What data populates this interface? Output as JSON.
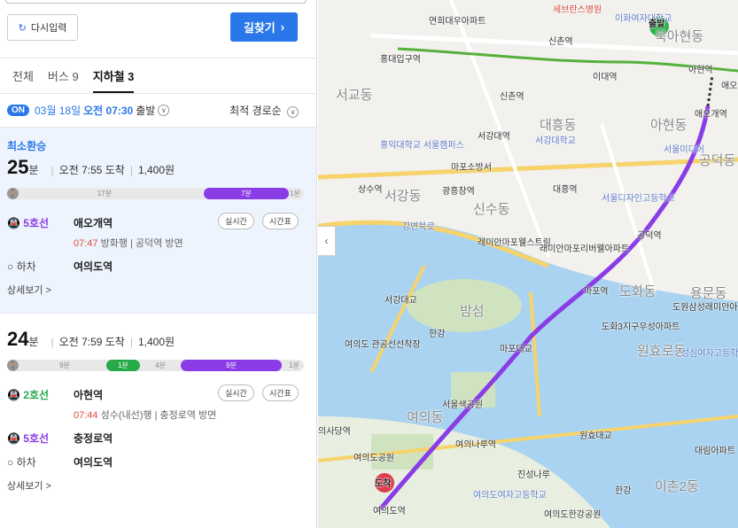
{
  "toolbar": {
    "reset_label": "다시입력",
    "find_label": "길찾기",
    "find_arrow": "›"
  },
  "tabs": [
    {
      "label": "전체"
    },
    {
      "label": "버스 9"
    },
    {
      "label": "지하철 3"
    }
  ],
  "filter": {
    "on": "ON",
    "date": "03월 18일",
    "time": "오전 07:30",
    "depart": "출발",
    "sort": "최적 경로순"
  },
  "routes": [
    {
      "badge": "최소환승",
      "minutes": "25",
      "unit": "분",
      "arrive": "오전 7:55 도착",
      "fare": "1,400원",
      "bar": {
        "walk1": "17분",
        "ride": "7분",
        "walk2": "1분"
      },
      "steps": [
        {
          "line": "5호선",
          "station": "애오개역",
          "time": "07:47",
          "dir": "방화행 | 공덕역 방면",
          "pill1": "실시간",
          "pill2": "시간표"
        },
        {
          "line": "하차",
          "station": "여의도역"
        }
      ],
      "detail": "상세보기 >"
    },
    {
      "minutes": "24",
      "unit": "분",
      "arrive": "오전 7:59 도착",
      "fare": "1,400원",
      "bar": {
        "walk1": "9분",
        "ride1": "1분",
        "walk2": "4분",
        "ride2": "9분",
        "walk3": "1분"
      },
      "steps": [
        {
          "line": "2호선",
          "station": "아현역",
          "time": "07:44",
          "dir": "성수(내선)행 | 충정로역 방면",
          "pill1": "실시간",
          "pill2": "시간표"
        },
        {
          "line": "5호선",
          "station": "충정로역"
        },
        {
          "line": "하차",
          "station": "여의도역"
        }
      ],
      "detail": "상세보기 >"
    }
  ],
  "map": {
    "labels": [
      "세브란스병원",
      "연희대우아파트",
      "이화여자대학교",
      "출발",
      "북아현동",
      "홍대입구역",
      "신촌역",
      "이대역",
      "아현역",
      "애오",
      "서교동",
      "신촌역",
      "서강대역",
      "대흥동",
      "서강대학교",
      "아현동",
      "애오개역",
      "서울미디어",
      "공덕동",
      "홍익대학교 서울캠퍼스",
      "마포소방서",
      "상수역",
      "서강동",
      "광흥창역",
      "신수동",
      "대흥역",
      "서울디자인고등학교",
      "공덕역",
      "강변북로",
      "레미안마포웰스트림",
      "래미안마포리버웰아파트",
      "마포역",
      "도화동",
      "용문동",
      "도원삼성래미안아파트",
      "서강대교",
      "밤섬",
      "한강",
      "여의도 관공선선착장",
      "마포대교",
      "도화3지구우성아파트",
      "원효로동",
      "성심여자고등학교",
      "서울색공원",
      "여의동",
      "의사당역",
      "여의나루역",
      "원효대교",
      "여의도공원",
      "도착",
      "진성나루",
      "한강",
      "이촌2동",
      "대림아파트",
      "여의도역",
      "여의도여자고등학교",
      "여의도한강공원"
    ]
  }
}
